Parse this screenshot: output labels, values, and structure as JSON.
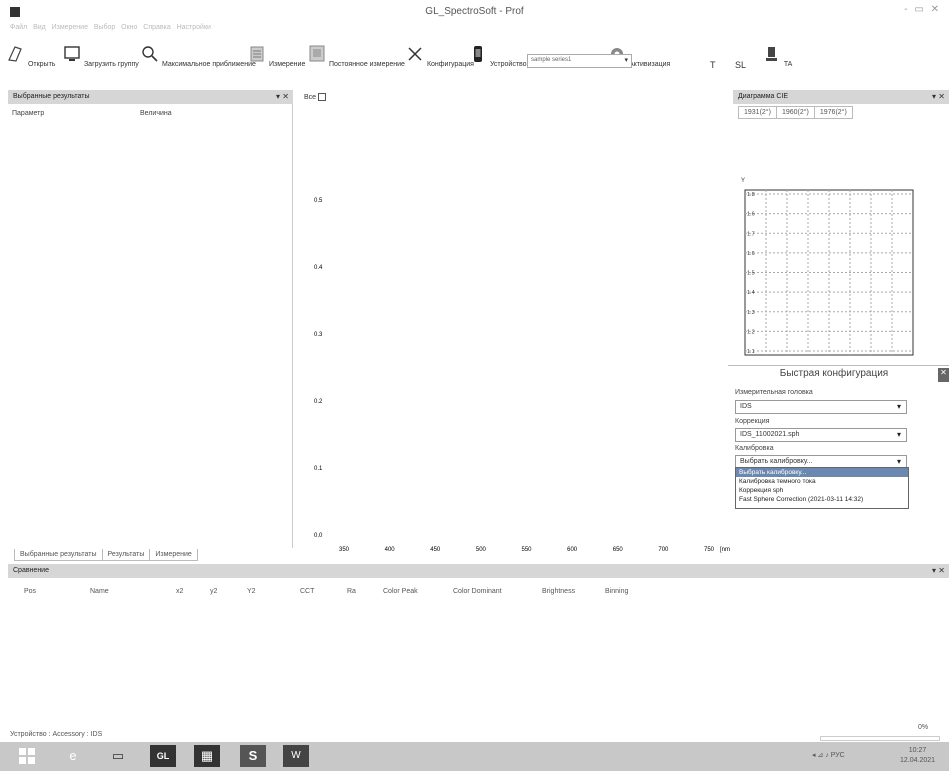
{
  "window": {
    "title": "GL_SpectroSoft - Prof",
    "controls": "- ▭ ✕"
  },
  "menu": {
    "items": [
      "Файл",
      "Вид",
      "Измерение",
      "Выбор",
      "Окно",
      "Справка",
      "Настройки"
    ]
  },
  "toolbar": {
    "open_label": "Открыть",
    "load_group_label": "Загрузить группу",
    "max_approx_label": "Максимальное приближение",
    "measure_label": "Измерение",
    "continuous_label": "Постоянное измерение",
    "config_label": "Конфигурация",
    "devices_label": "Устройство",
    "sample_select_value": "sample series1",
    "activation_label": "Активизация",
    "t_label": "T",
    "sl_label": "SL",
    "ta_label": "TA"
  },
  "left_panel": {
    "header": "Выбранные результаты",
    "col_param": "Параметр",
    "col_value": "Величина",
    "tabs": [
      "Выбранные результаты",
      "Результаты",
      "Измерение"
    ]
  },
  "center_panel": {
    "checkbox_label": "Все"
  },
  "chart_data": {
    "type": "line",
    "xlabel": "[nm]",
    "ylabel": "",
    "x_ticks": [
      350,
      400,
      450,
      500,
      550,
      600,
      650,
      700,
      750
    ],
    "y_ticks": [
      0.5,
      0.4,
      0.3,
      0.2,
      0.1,
      0.0
    ],
    "xlim": [
      350,
      750
    ],
    "ylim": [
      0.0,
      0.5
    ],
    "series": []
  },
  "right_panel": {
    "header": "Диаграмма CIE",
    "tabs": [
      "1931(2°)",
      "1960(2°)",
      "1976(2°)"
    ],
    "axis_label": "Y",
    "cie_y_ticks": [
      1.8,
      1.6,
      1.7,
      1.6,
      1.5,
      1.4,
      1.3,
      1.2,
      1.1
    ]
  },
  "quick_config": {
    "title": "Быстрая конфигурация",
    "head_label": "Измерительная головка",
    "head_value": "IDS",
    "correction_label": "Коррекция",
    "correction_value": "IDS_11002021.sph",
    "calibration_label": "Калибровка",
    "calibration_value": "Выбрать калибровку...",
    "calibration_options": [
      "Выбрать калибровку...",
      "Калибровка темного тока",
      "Коррекция sph",
      "Fast Sphere Correction (2021-03-11 14:32)"
    ]
  },
  "comparison": {
    "header": "Сравнение",
    "columns": [
      "Pos",
      "Name",
      "x2",
      "y2",
      "Y2",
      "CCT",
      "Ra",
      "Color Peak",
      "Color Dominant",
      "Brightness",
      "Binning"
    ]
  },
  "statusbar": {
    "left": "Устройство : Accessory : IDS",
    "right": "0%"
  },
  "taskbar": {
    "tray": "◂ ⊿ ♪ РУС",
    "time": "10:27",
    "date": "12.04.2021"
  }
}
